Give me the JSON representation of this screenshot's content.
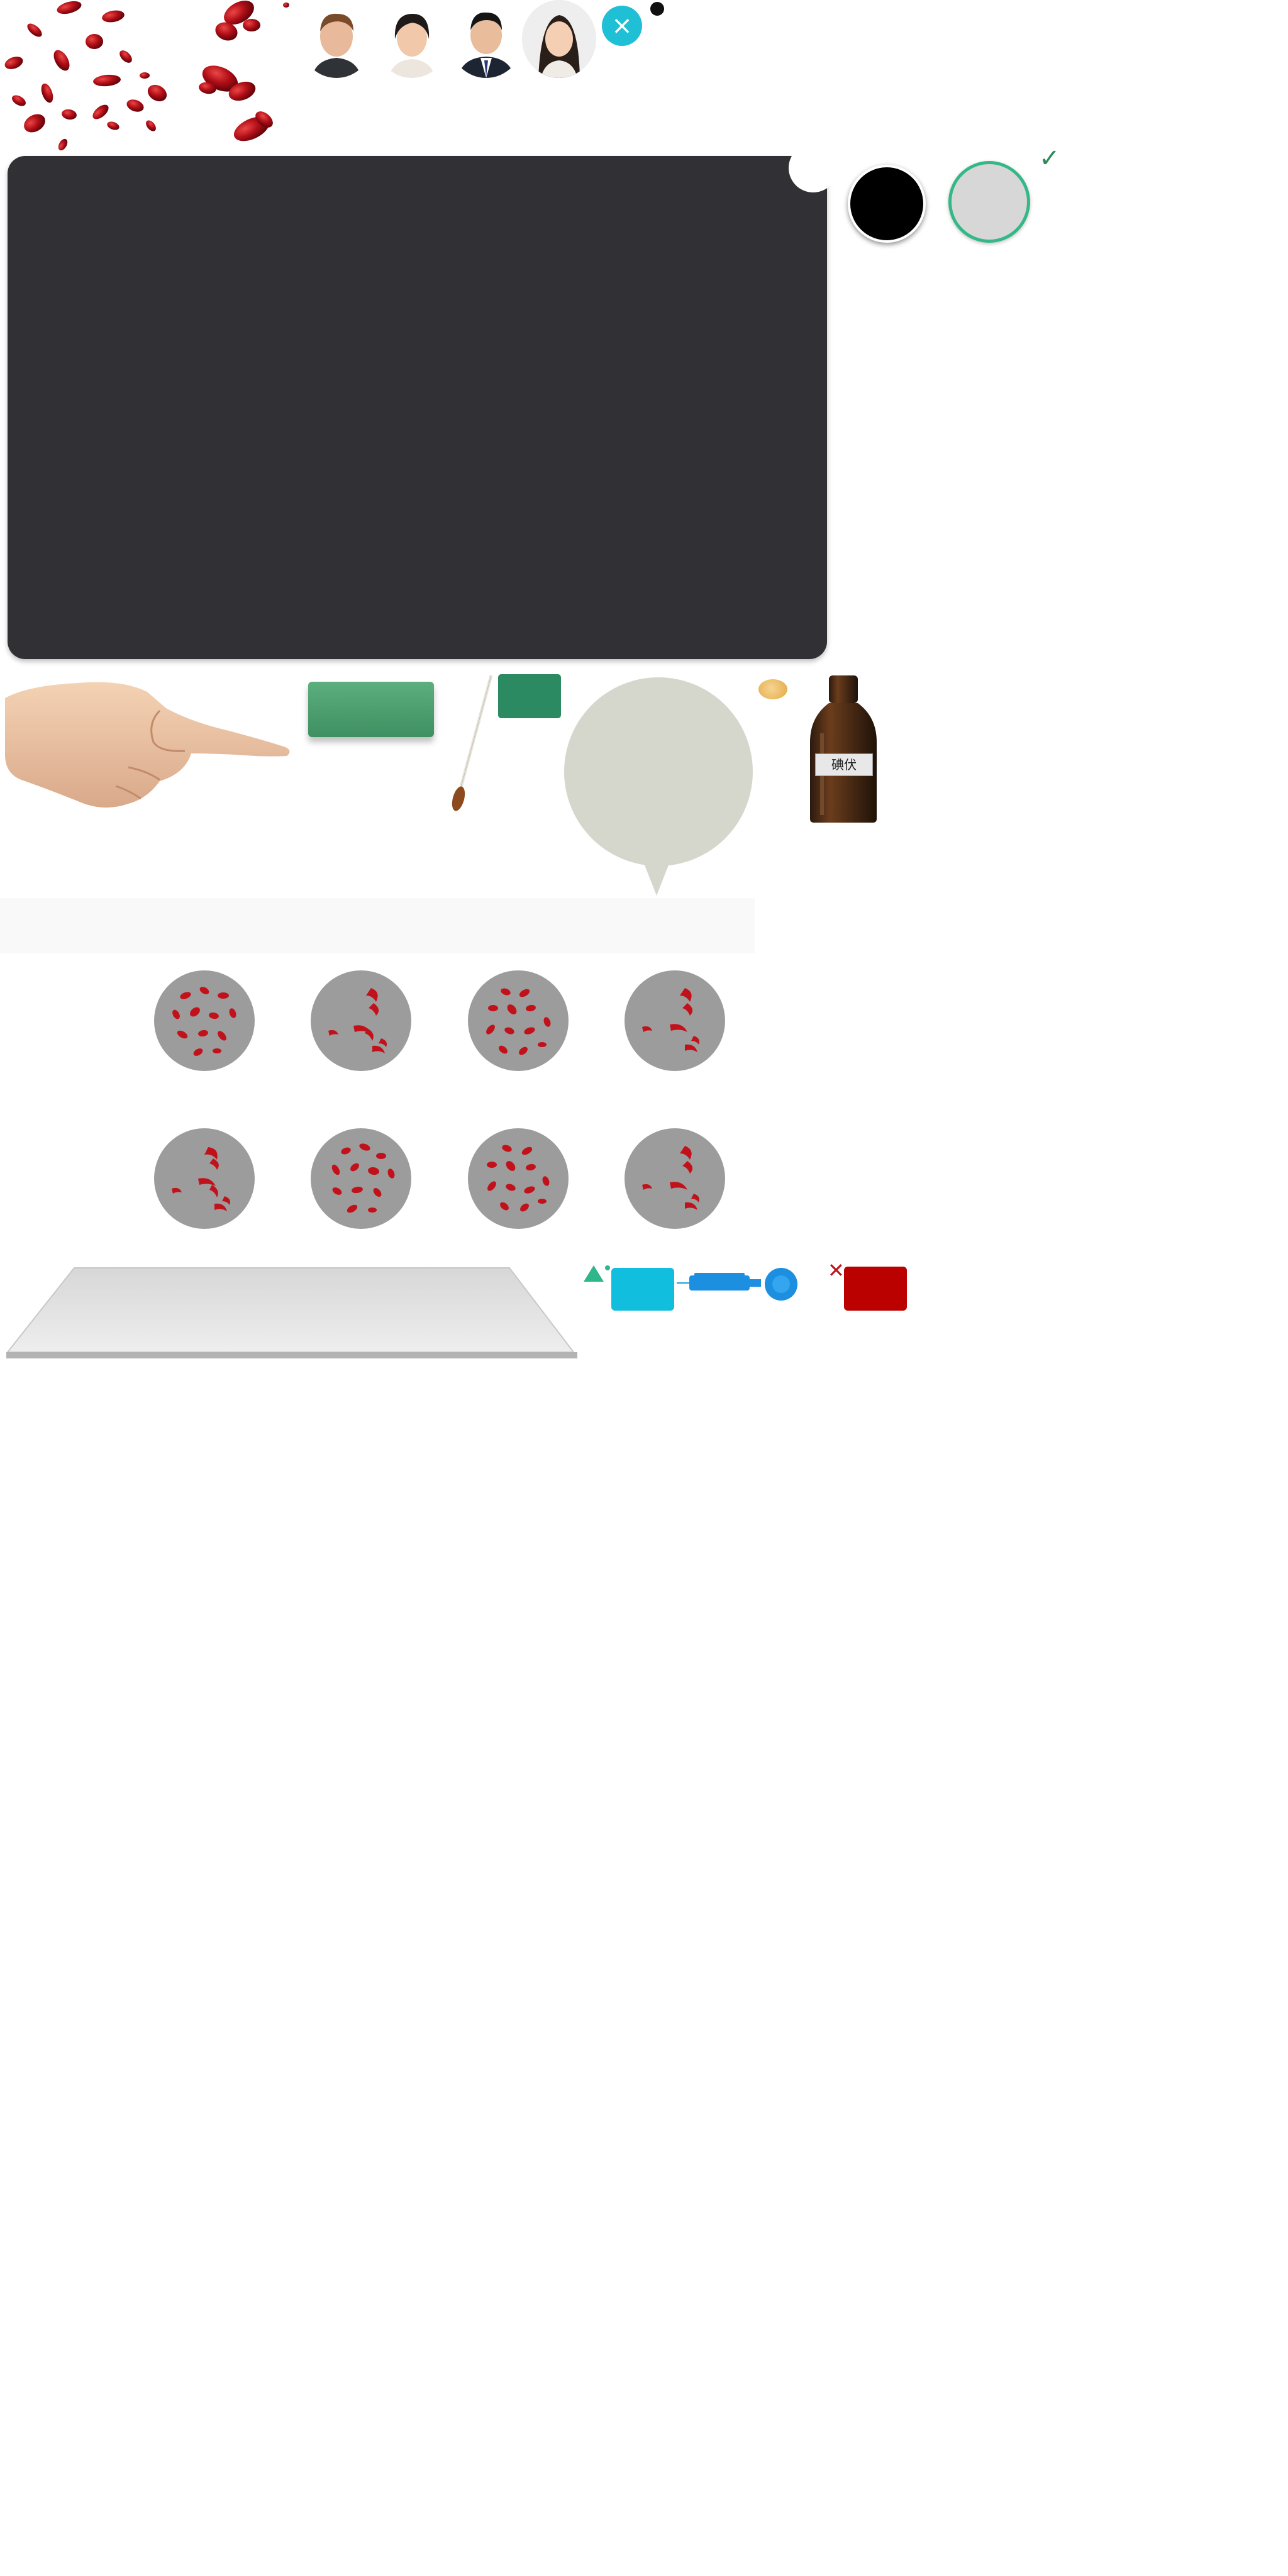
{
  "header": {
    "close_icon": "×",
    "avatars": [
      {
        "name": "avatar-man-brown-hair"
      },
      {
        "name": "avatar-woman-dark-hair"
      },
      {
        "name": "avatar-man-suit"
      },
      {
        "name": "avatar-woman-long-hair"
      }
    ]
  },
  "status": {
    "check_icon": "✓"
  },
  "bottle": {
    "label": "碘伏"
  },
  "dishes": {
    "row_count": 2,
    "per_row": 4
  },
  "controls": {
    "wrong_icon": "✕"
  },
  "colors": {
    "panel": "#313035",
    "accent_teal": "#1fc0d6",
    "accent_green": "#35b888",
    "button_green": "#4a9a6c",
    "red": "#bb0000"
  }
}
